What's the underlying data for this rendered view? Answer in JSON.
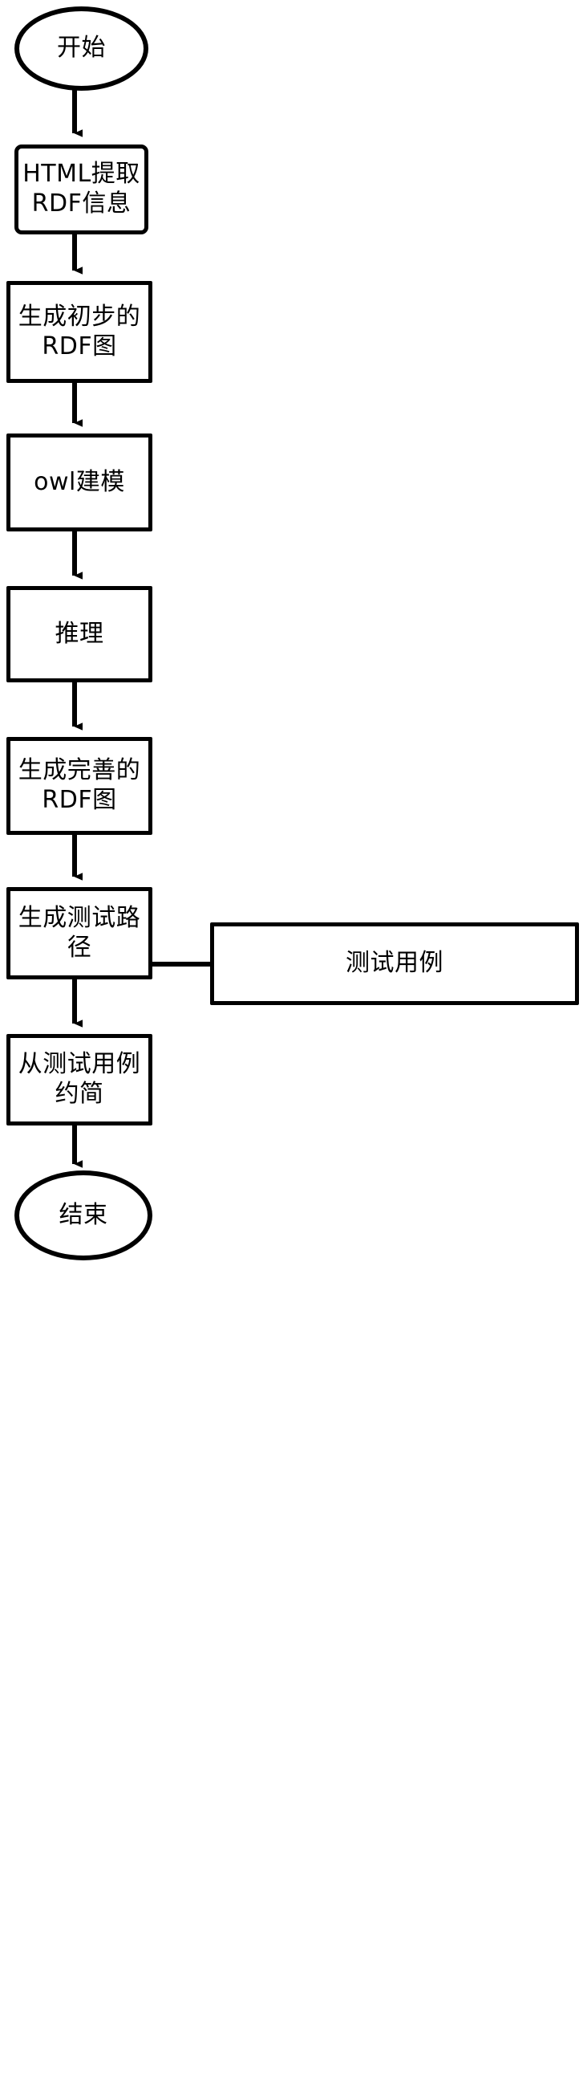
{
  "diagram": {
    "type": "flowchart",
    "orientation": "vertical",
    "line_color": "#000000",
    "fill_color": "#ffffff",
    "text_color": "#000000",
    "nodes": [
      {
        "id": "start",
        "shape": "ellipse",
        "label": "开始"
      },
      {
        "id": "extract",
        "shape": "rectangle",
        "label": "HTML提取\nRDF信息"
      },
      {
        "id": "prelim-rdf",
        "shape": "rectangle",
        "label": "生成初步的\nRDF图"
      },
      {
        "id": "owl-model",
        "shape": "rectangle",
        "label": "owl建模"
      },
      {
        "id": "reasoning",
        "shape": "rectangle",
        "label": "推理"
      },
      {
        "id": "final-rdf",
        "shape": "rectangle",
        "label": "生成完善的\nRDF图"
      },
      {
        "id": "test-path",
        "shape": "rectangle",
        "label": "生成测试路\n径"
      },
      {
        "id": "test-cases",
        "shape": "rectangle",
        "label": "测试用例"
      },
      {
        "id": "reduce-cases",
        "shape": "rectangle",
        "label": "从测试用例\n约简"
      },
      {
        "id": "end",
        "shape": "ellipse",
        "label": "结束"
      }
    ],
    "edges": [
      {
        "from": "start",
        "to": "extract",
        "arrow": "down"
      },
      {
        "from": "extract",
        "to": "prelim-rdf",
        "arrow": "down"
      },
      {
        "from": "prelim-rdf",
        "to": "owl-model",
        "arrow": "down"
      },
      {
        "from": "owl-model",
        "to": "reasoning",
        "arrow": "down"
      },
      {
        "from": "reasoning",
        "to": "final-rdf",
        "arrow": "down"
      },
      {
        "from": "final-rdf",
        "to": "test-path",
        "arrow": "down"
      },
      {
        "from": "test-path",
        "to": "reduce-cases",
        "arrow": "down"
      },
      {
        "from": "test-cases",
        "to": "reduce-cases",
        "arrow": "none"
      },
      {
        "from": "reduce-cases",
        "to": "end",
        "arrow": "down"
      }
    ]
  }
}
